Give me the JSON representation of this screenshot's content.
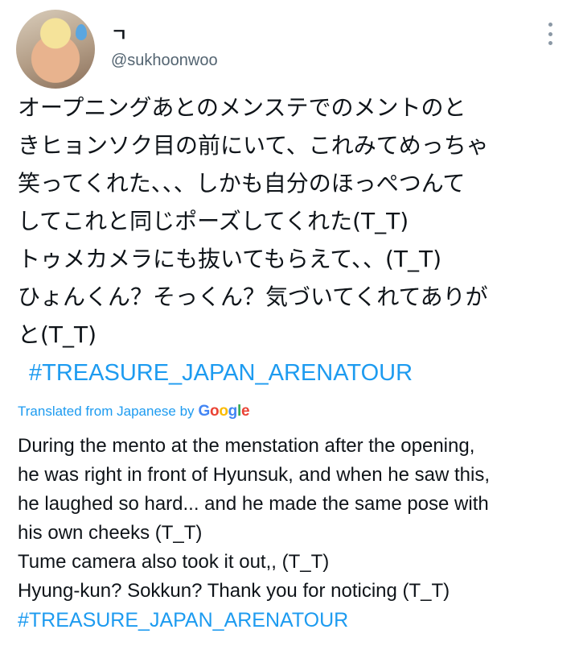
{
  "user": {
    "display_name": "ㄱ",
    "handle": "@sukhoonwoo"
  },
  "tweet": {
    "lines": [
      "オープニングあとのメンステでのメントのと",
      "きヒョンソク目の前にいて、これみてめっちゃ",
      "笑ってくれた、、、しかも自分のほっぺつんて",
      "してこれと同じポーズしてくれた(T_T)",
      "トゥメカメラにも抜いてもらえて、、(T_T)",
      "ひょんくん？そっくん？気づいてくれてありが",
      "と(T_T)"
    ],
    "hashtag": "#TREASURE_JAPAN_ARENATOUR"
  },
  "translation": {
    "label": "Translated from Japanese by",
    "provider": "Google",
    "lines": [
      "During the mento at the menstation after the opening,",
      "he was right in front of Hyunsuk, and when he saw this,",
      "he laughed so hard... and he made the same pose with",
      "his own cheeks (T_T)",
      "Tume camera also took it out,, (T_T)",
      "Hyung-kun? Sokkun? Thank you for noticing (T_T)"
    ],
    "hashtag": "#TREASURE_JAPAN_ARENATOUR"
  },
  "icons": {
    "more": "more-vertical-icon",
    "avatar_emoji": "sweat-droplet-icon"
  },
  "colors": {
    "link": "#1d9bf0",
    "secondary_text": "#536471",
    "text": "#0f1419"
  }
}
